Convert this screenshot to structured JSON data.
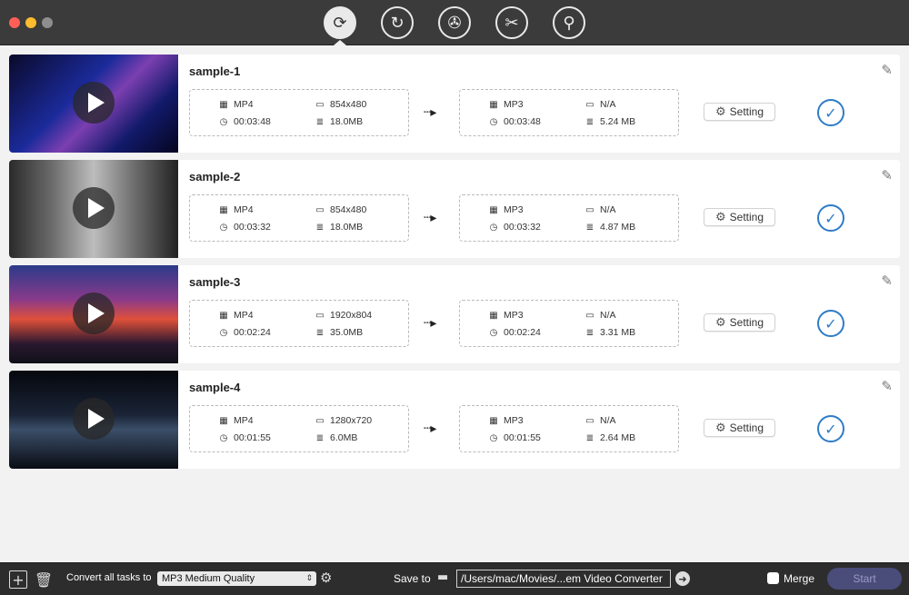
{
  "toolbar": {
    "tools": [
      {
        "name": "convert-tool",
        "icon": "convert-icon",
        "glyph": "⟳"
      },
      {
        "name": "rotate-tool",
        "icon": "rotate-icon",
        "glyph": "↻"
      },
      {
        "name": "film-tool-1",
        "icon": "film-reel-icon",
        "glyph": "✇"
      },
      {
        "name": "film-tool-2",
        "icon": "film-reel-scissors-icon",
        "glyph": "✂"
      },
      {
        "name": "film-tool-3",
        "icon": "film-reel-search-icon",
        "glyph": "⚲"
      }
    ]
  },
  "tasks": [
    {
      "name": "sample-1",
      "source": {
        "format": "MP4",
        "resolution": "854x480",
        "duration": "00:03:48",
        "size": "18.0MB"
      },
      "target": {
        "format": "MP3",
        "resolution": "N/A",
        "duration": "00:03:48",
        "size": "5.24 MB"
      },
      "setting_label": "Setting"
    },
    {
      "name": "sample-2",
      "source": {
        "format": "MP4",
        "resolution": "854x480",
        "duration": "00:03:32",
        "size": "18.0MB"
      },
      "target": {
        "format": "MP3",
        "resolution": "N/A",
        "duration": "00:03:32",
        "size": "4.87 MB"
      },
      "setting_label": "Setting"
    },
    {
      "name": "sample-3",
      "source": {
        "format": "MP4",
        "resolution": "1920x804",
        "duration": "00:02:24",
        "size": "35.0MB"
      },
      "target": {
        "format": "MP3",
        "resolution": "N/A",
        "duration": "00:02:24",
        "size": "3.31 MB"
      },
      "setting_label": "Setting"
    },
    {
      "name": "sample-4",
      "source": {
        "format": "MP4",
        "resolution": "1280x720",
        "duration": "00:01:55",
        "size": "6.0MB"
      },
      "target": {
        "format": "MP3",
        "resolution": "N/A",
        "duration": "00:01:55",
        "size": "2.64 MB"
      },
      "setting_label": "Setting"
    }
  ],
  "bottom": {
    "convert_all_label": "Convert all tasks to",
    "convert_all_value": "MP3 Medium Quality",
    "save_to_label": "Save to",
    "save_path": "/Users/mac/Movies/...em Video Converter",
    "merge_label": "Merge",
    "start_label": "Start"
  },
  "colors": {
    "accent": "#2f7cc7",
    "start_button": "#4a4c7a",
    "toolbar_bg": "#3b3b3b",
    "bottom_bg": "#2d2d2d"
  }
}
